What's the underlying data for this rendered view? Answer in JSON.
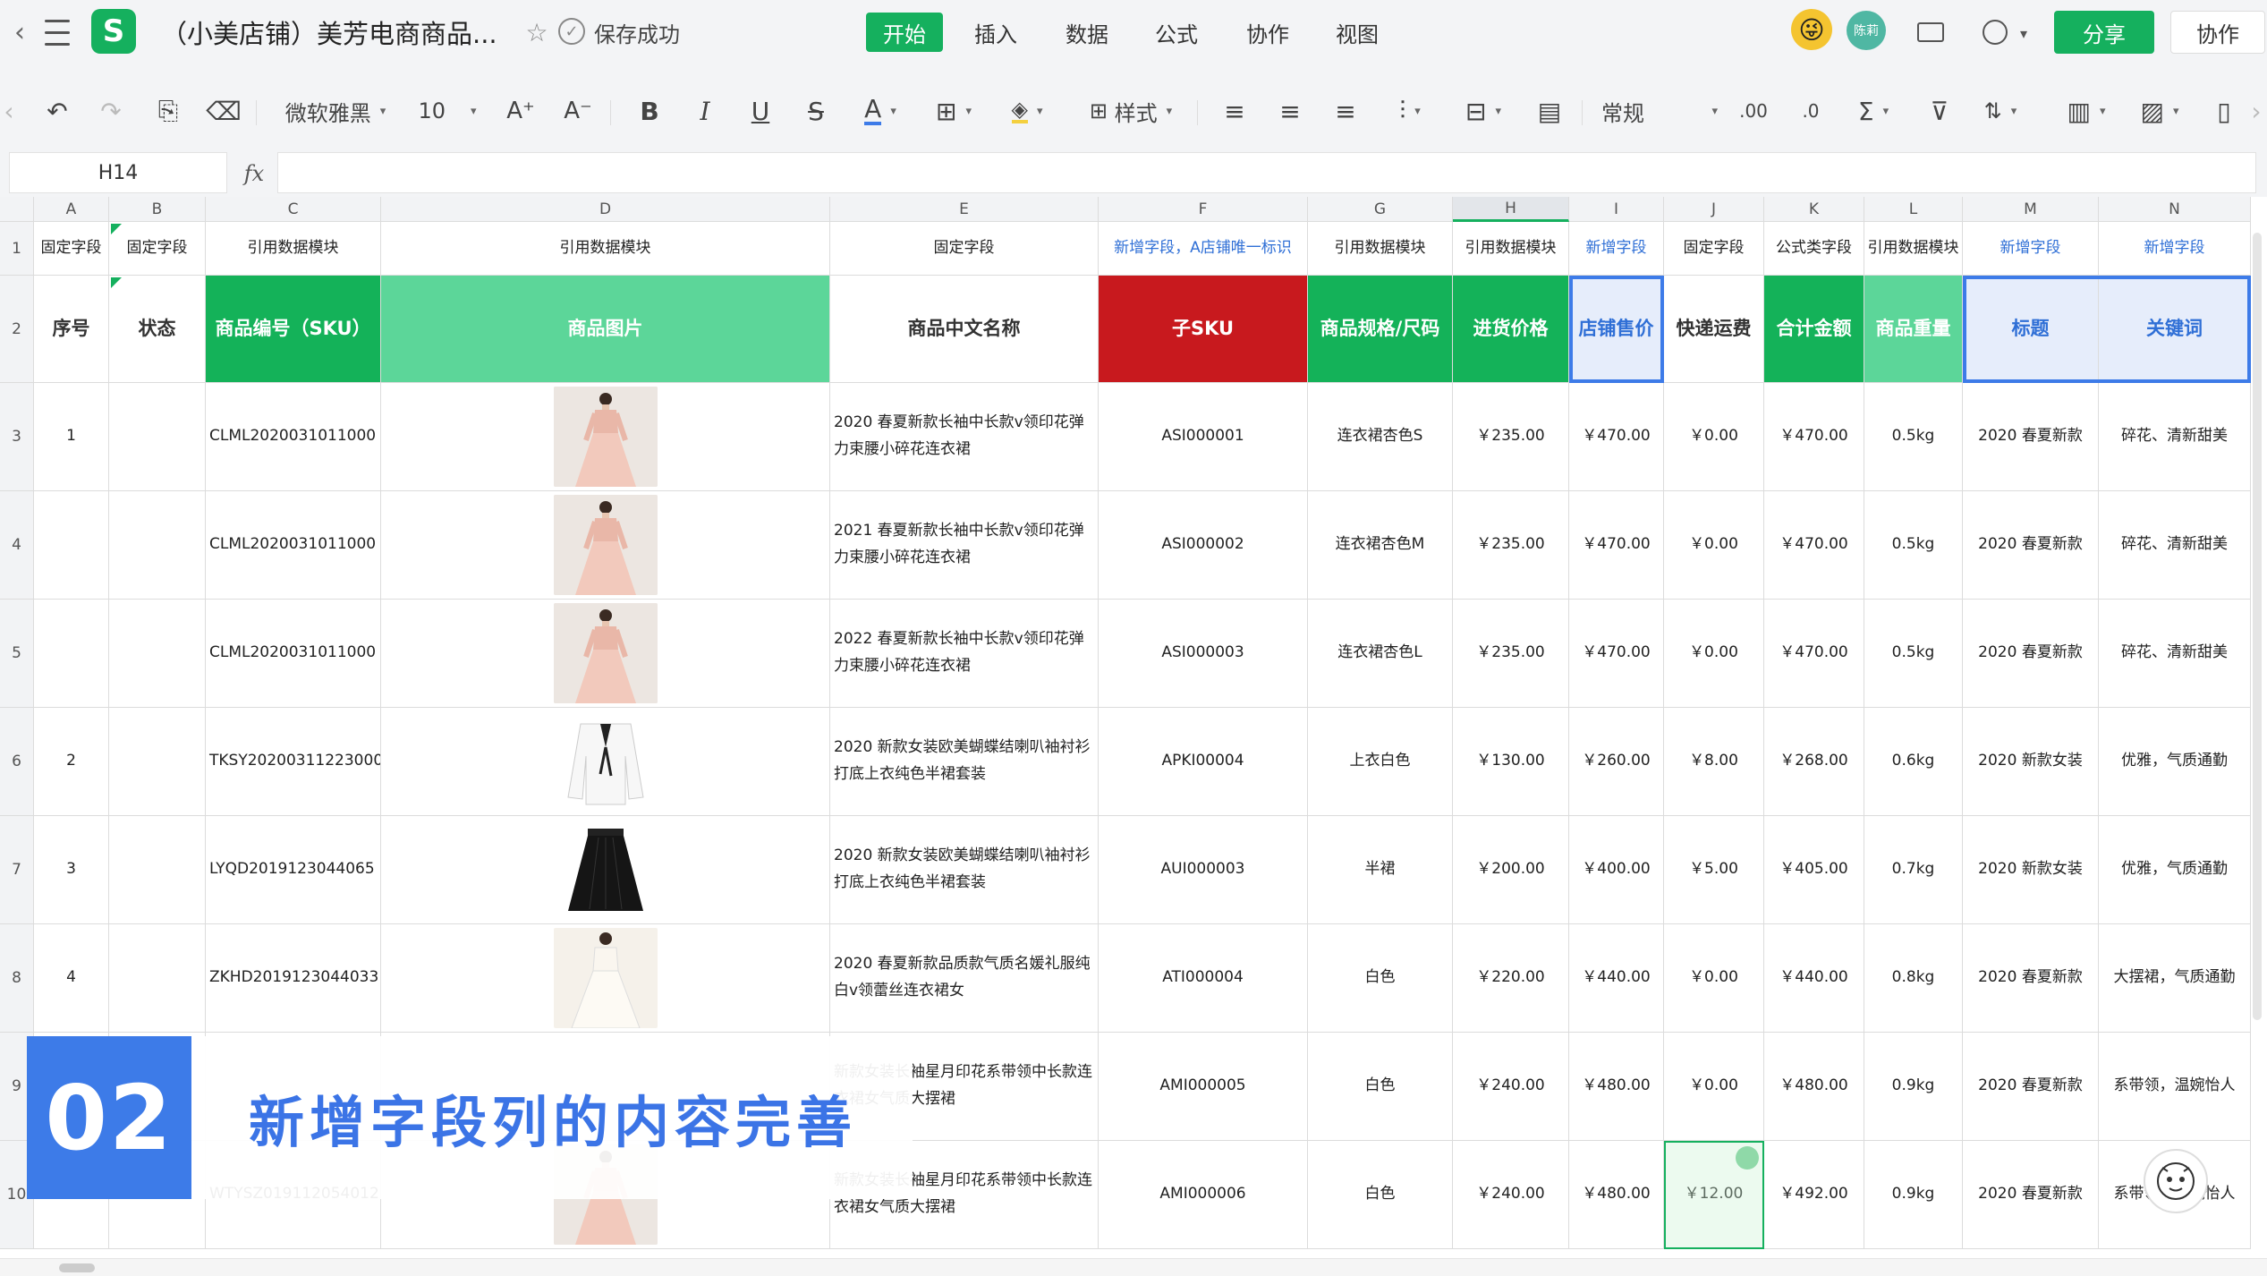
{
  "app": {
    "logo_letter": "S",
    "title": "（小美店铺）美芳电商商品...",
    "save_status": "保存成功"
  },
  "tabs": [
    "开始",
    "插入",
    "数据",
    "公式",
    "协作",
    "视图"
  ],
  "header_right": {
    "user_initials": "陈莉",
    "share_label": "分享",
    "collab_label": "协作"
  },
  "toolbar": {
    "font_name": "微软雅黑",
    "font_size": "10",
    "style_label": "样式",
    "number_format": "常规",
    "decimal_inc": ".00",
    "decimal_dec": ".0"
  },
  "formula_bar": {
    "cell_ref": "H14",
    "fx": "fx",
    "content": ""
  },
  "columns": [
    "A",
    "B",
    "C",
    "D",
    "E",
    "F",
    "G",
    "H",
    "I",
    "J",
    "K",
    "L",
    "M",
    "N"
  ],
  "row_numbers": [
    "1",
    "2",
    "3",
    "4",
    "5",
    "6",
    "7",
    "8",
    "9",
    "10"
  ],
  "row1": [
    "固定字段",
    "固定字段",
    "引用数据模块",
    "引用数据模块",
    "固定字段",
    "新增字段，A店铺唯一标识",
    "引用数据模块",
    "引用数据模块",
    "新增字段",
    "固定字段",
    "公式类字段",
    "引用数据模块",
    "新增字段",
    "新增字段"
  ],
  "row2": [
    "序号",
    "状态",
    "商品编号（SKU）",
    "商品图片",
    "商品中文名称",
    "子SKU",
    "商品规格/尺码",
    "进货价格",
    "店铺售价",
    "快递运费",
    "合计金额",
    "商品重量",
    "标题",
    "关键词"
  ],
  "rows": [
    {
      "seq": "1",
      "status": "",
      "sku": "CLML2020031011000",
      "image": "dress-pink",
      "name": "2020 春夏新款长袖中长款v领印花弹力束腰小碎花连衣裙",
      "sub_sku": "ASI000001",
      "spec": "连衣裙杏色S",
      "cost": "￥235.00",
      "price": "￥470.00",
      "shipping": "￥0.00",
      "total": "￥470.00",
      "weight": "0.5kg",
      "title": "2020 春夏新款",
      "keywords": "碎花、清新甜美"
    },
    {
      "seq": "",
      "status": "",
      "sku": "CLML2020031011000",
      "image": "dress-pink",
      "name": "2021 春夏新款长袖中长款v领印花弹力束腰小碎花连衣裙",
      "sub_sku": "ASI000002",
      "spec": "连衣裙杏色M",
      "cost": "￥235.00",
      "price": "￥470.00",
      "shipping": "￥0.00",
      "total": "￥470.00",
      "weight": "0.5kg",
      "title": "2020 春夏新款",
      "keywords": "碎花、清新甜美"
    },
    {
      "seq": "",
      "status": "",
      "sku": "CLML2020031011000",
      "image": "dress-pink",
      "name": "2022 春夏新款长袖中长款v领印花弹力束腰小碎花连衣裙",
      "sub_sku": "ASI000003",
      "spec": "连衣裙杏色L",
      "cost": "￥235.00",
      "price": "￥470.00",
      "shipping": "￥0.00",
      "total": "￥470.00",
      "weight": "0.5kg",
      "title": "2020 春夏新款",
      "keywords": "碎花、清新甜美"
    },
    {
      "seq": "2",
      "status": "",
      "sku": "TKSY20200311223000",
      "image": "blouse-white",
      "name": "2020 新款女装欧美蝴蝶结喇叭袖衬衫打底上衣纯色半裙套装",
      "sub_sku": "APKI00004",
      "spec": "上衣白色",
      "cost": "￥130.00",
      "price": "￥260.00",
      "shipping": "￥8.00",
      "total": "￥268.00",
      "weight": "0.6kg",
      "title": "2020 新款女装",
      "keywords": "优雅，气质通勤"
    },
    {
      "seq": "3",
      "status": "",
      "sku": "LYQD2019123044065",
      "image": "skirt-black",
      "name": "2020 新款女装欧美蝴蝶结喇叭袖衬衫打底上衣纯色半裙套装",
      "sub_sku": "AUI000003",
      "spec": "半裙",
      "cost": "￥200.00",
      "price": "￥400.00",
      "shipping": "￥5.00",
      "total": "￥405.00",
      "weight": "0.7kg",
      "title": "2020 新款女装",
      "keywords": "优雅，气质通勤"
    },
    {
      "seq": "4",
      "status": "",
      "sku": "ZKHD2019123044033",
      "image": "dress-white",
      "name": "2020 春夏新款品质款气质名媛礼服纯白v领蕾丝连衣裙女",
      "sub_sku": "ATI000004",
      "spec": "白色",
      "cost": "￥220.00",
      "price": "￥440.00",
      "shipping": "￥0.00",
      "total": "￥440.00",
      "weight": "0.8kg",
      "title": "2020 春夏新款",
      "keywords": "大摆裙，气质通勤"
    },
    {
      "seq": "",
      "status": "",
      "sku": "",
      "image": "",
      "name": "新款女装长袖星月印花系带领中长款连衣裙女气质大摆裙",
      "sub_sku": "AMI000005",
      "spec": "白色",
      "cost": "￥240.00",
      "price": "￥480.00",
      "shipping": "￥0.00",
      "total": "￥480.00",
      "weight": "0.9kg",
      "title": "2020 春夏新款",
      "keywords": "系带领，温婉怡人"
    },
    {
      "seq": "",
      "status": "",
      "sku": "WTYSZ019112054012",
      "image": "dress-lace",
      "name": "新款女装长袖星月印花系带领中长款连衣裙女气质大摆裙",
      "sub_sku": "AMI000006",
      "spec": "白色",
      "cost": "￥240.00",
      "price": "￥480.00",
      "shipping": "￥12.00",
      "total": "￥492.00",
      "weight": "0.9kg",
      "title": "2020 春夏新款",
      "keywords": "系带领，温婉怡人"
    }
  ],
  "overlay": {
    "number": "02",
    "text": "新增字段列的内容完善"
  },
  "colors": {
    "accent": "#15b05e",
    "header_green": "#14b259",
    "header_light_green": "#5cd699",
    "header_red": "#c8191e",
    "selection_blue": "#3d7be8"
  }
}
